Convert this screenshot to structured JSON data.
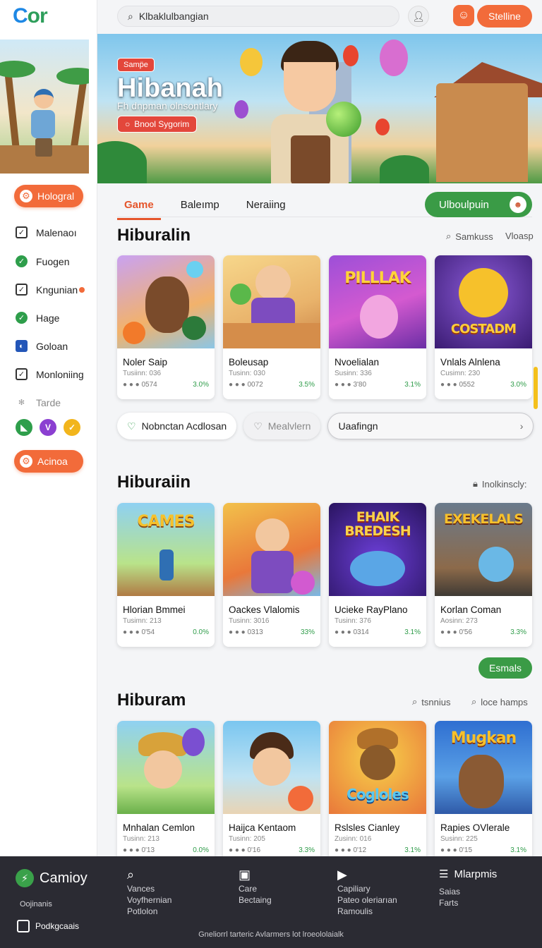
{
  "brand": {
    "logo_c": "C",
    "logo_rest": "or"
  },
  "search": {
    "value": "Klbaklulbangian",
    "placeholder": "Klbaklulbangian"
  },
  "top": {
    "cta": "Stelline"
  },
  "sidebar": {
    "primary_button": "Hologral",
    "items": [
      {
        "label": "Malenaoı",
        "icon": "checkbox-icon"
      },
      {
        "label": "Fuogen",
        "icon": "check-circle-icon"
      },
      {
        "label": "Kngunian",
        "icon": "checkbox-icon",
        "badge": true
      },
      {
        "label": "Hage",
        "icon": "check-circle-icon"
      },
      {
        "label": "Goloan",
        "icon": "shield-icon"
      },
      {
        "label": "Monloniing",
        "icon": "checkbox-icon"
      },
      {
        "label": "Tarde",
        "icon": "sparkle-icon"
      }
    ],
    "secondary_button": "Acinoa"
  },
  "hero": {
    "tag": "Samp̈e",
    "title": "Hibanah",
    "subtitle": "Fh dnpman olnsontlary",
    "button": "Bnool Sygorim"
  },
  "tabs": [
    {
      "label": "Game",
      "active": true
    },
    {
      "label": "Baleımp",
      "active": false
    },
    {
      "label": "Neraiing",
      "active": false
    }
  ],
  "tab_cta": "Ulboulpuin",
  "sections": [
    {
      "title": "Hiburalin",
      "links": [
        "Samkuss",
        "Vloasp"
      ],
      "cards": [
        {
          "name": "Noler Saip",
          "meta": "Tusiinn: 036",
          "dots": "● ● ●  0574",
          "pct": "3.0%"
        },
        {
          "name": "Boleusap",
          "meta": "Tusinn: 030",
          "dots": "● ● ●  0072",
          "pct": "3.5%"
        },
        {
          "name": "Nvoelialan",
          "meta": "Susinn: 336",
          "dots": "● ● ●  3'80",
          "pct": "3.1%"
        },
        {
          "name": "Vnlals Alnlena",
          "meta": "Cusimn: 230",
          "dots": "● ● ●  0552",
          "pct": "3.0%"
        }
      ]
    },
    {
      "title": "Hiburaiin",
      "links": [
        "Inolkinscly:"
      ],
      "cards": [
        {
          "name": "Hlorian Bmmei",
          "meta": "Tusimn: 213",
          "dots": "● ● ●  0'54",
          "pct": "0.0%"
        },
        {
          "name": "Oackes Vlalomis",
          "meta": "Tusinn: 3016",
          "dots": "● ● ●  0313",
          "pct": "33%"
        },
        {
          "name": "Ucieke RayPlano",
          "meta": "Tusinn: 376",
          "dots": "● ● ●  0314",
          "pct": "3.1%"
        },
        {
          "name": "Korlan Coman",
          "meta": "Aosinn: 273",
          "dots": "● ● ●  0'56",
          "pct": "3.3%"
        }
      ]
    },
    {
      "title": "Hiburam",
      "links": [
        "tsnnius",
        "loce hamps"
      ],
      "cards": [
        {
          "name": "Mnhalan Cemlon",
          "meta": "Tusinn: 213",
          "dots": "● ● ●  0'13",
          "pct": "0.0%"
        },
        {
          "name": "Haijca Kentaom",
          "meta": "Tusinn: 205",
          "dots": "● ● ●  0'16",
          "pct": "3.3%"
        },
        {
          "name": "Rslsles Cianley",
          "meta": "Zusinn: 016",
          "dots": "● ● ●  0'12",
          "pct": "3.1%"
        },
        {
          "name": "Rapies OVlerale",
          "meta": "Susinn: 225",
          "dots": "● ● ●  0'15",
          "pct": "3.1%"
        }
      ]
    }
  ],
  "thumb_words": {
    "s1c3": "PILLLAK",
    "s1c4": "COSTADM",
    "s2c1": "CAMES",
    "s2c3": "EHAIK BREDESH",
    "s2c4": "EXEKELALS",
    "s3c3": "Cogloles",
    "s3c4": "Mugkan"
  },
  "pills": {
    "p1": "Nobnctan  Acdlosan",
    "p2": "Mealvlern",
    "p3": "Uaafingn"
  },
  "green_button": "Esmals",
  "footer": {
    "brand": "Camioy",
    "brand_sub": "Oojinanis",
    "pod": "Podkgcaais",
    "cols": [
      {
        "title": "",
        "lines": [
          "Vances",
          "Voyfhernian",
          "Potlolon"
        ]
      },
      {
        "title": "",
        "lines": [
          "Care",
          "Bectaing"
        ]
      },
      {
        "title": "",
        "lines": [
          "Capiliary",
          "Pateo oleriarıan",
          "Ramoulis"
        ]
      },
      {
        "title": "Mlarpmis",
        "lines": [
          "Saias",
          "Farts"
        ]
      }
    ],
    "bottom": "Gneliorrl tarteric Avlarmers lot lroeololaialk"
  },
  "colors": {
    "accent": "#f26b3a",
    "green": "#3a9b46",
    "footer_bg": "#2b2b33"
  }
}
